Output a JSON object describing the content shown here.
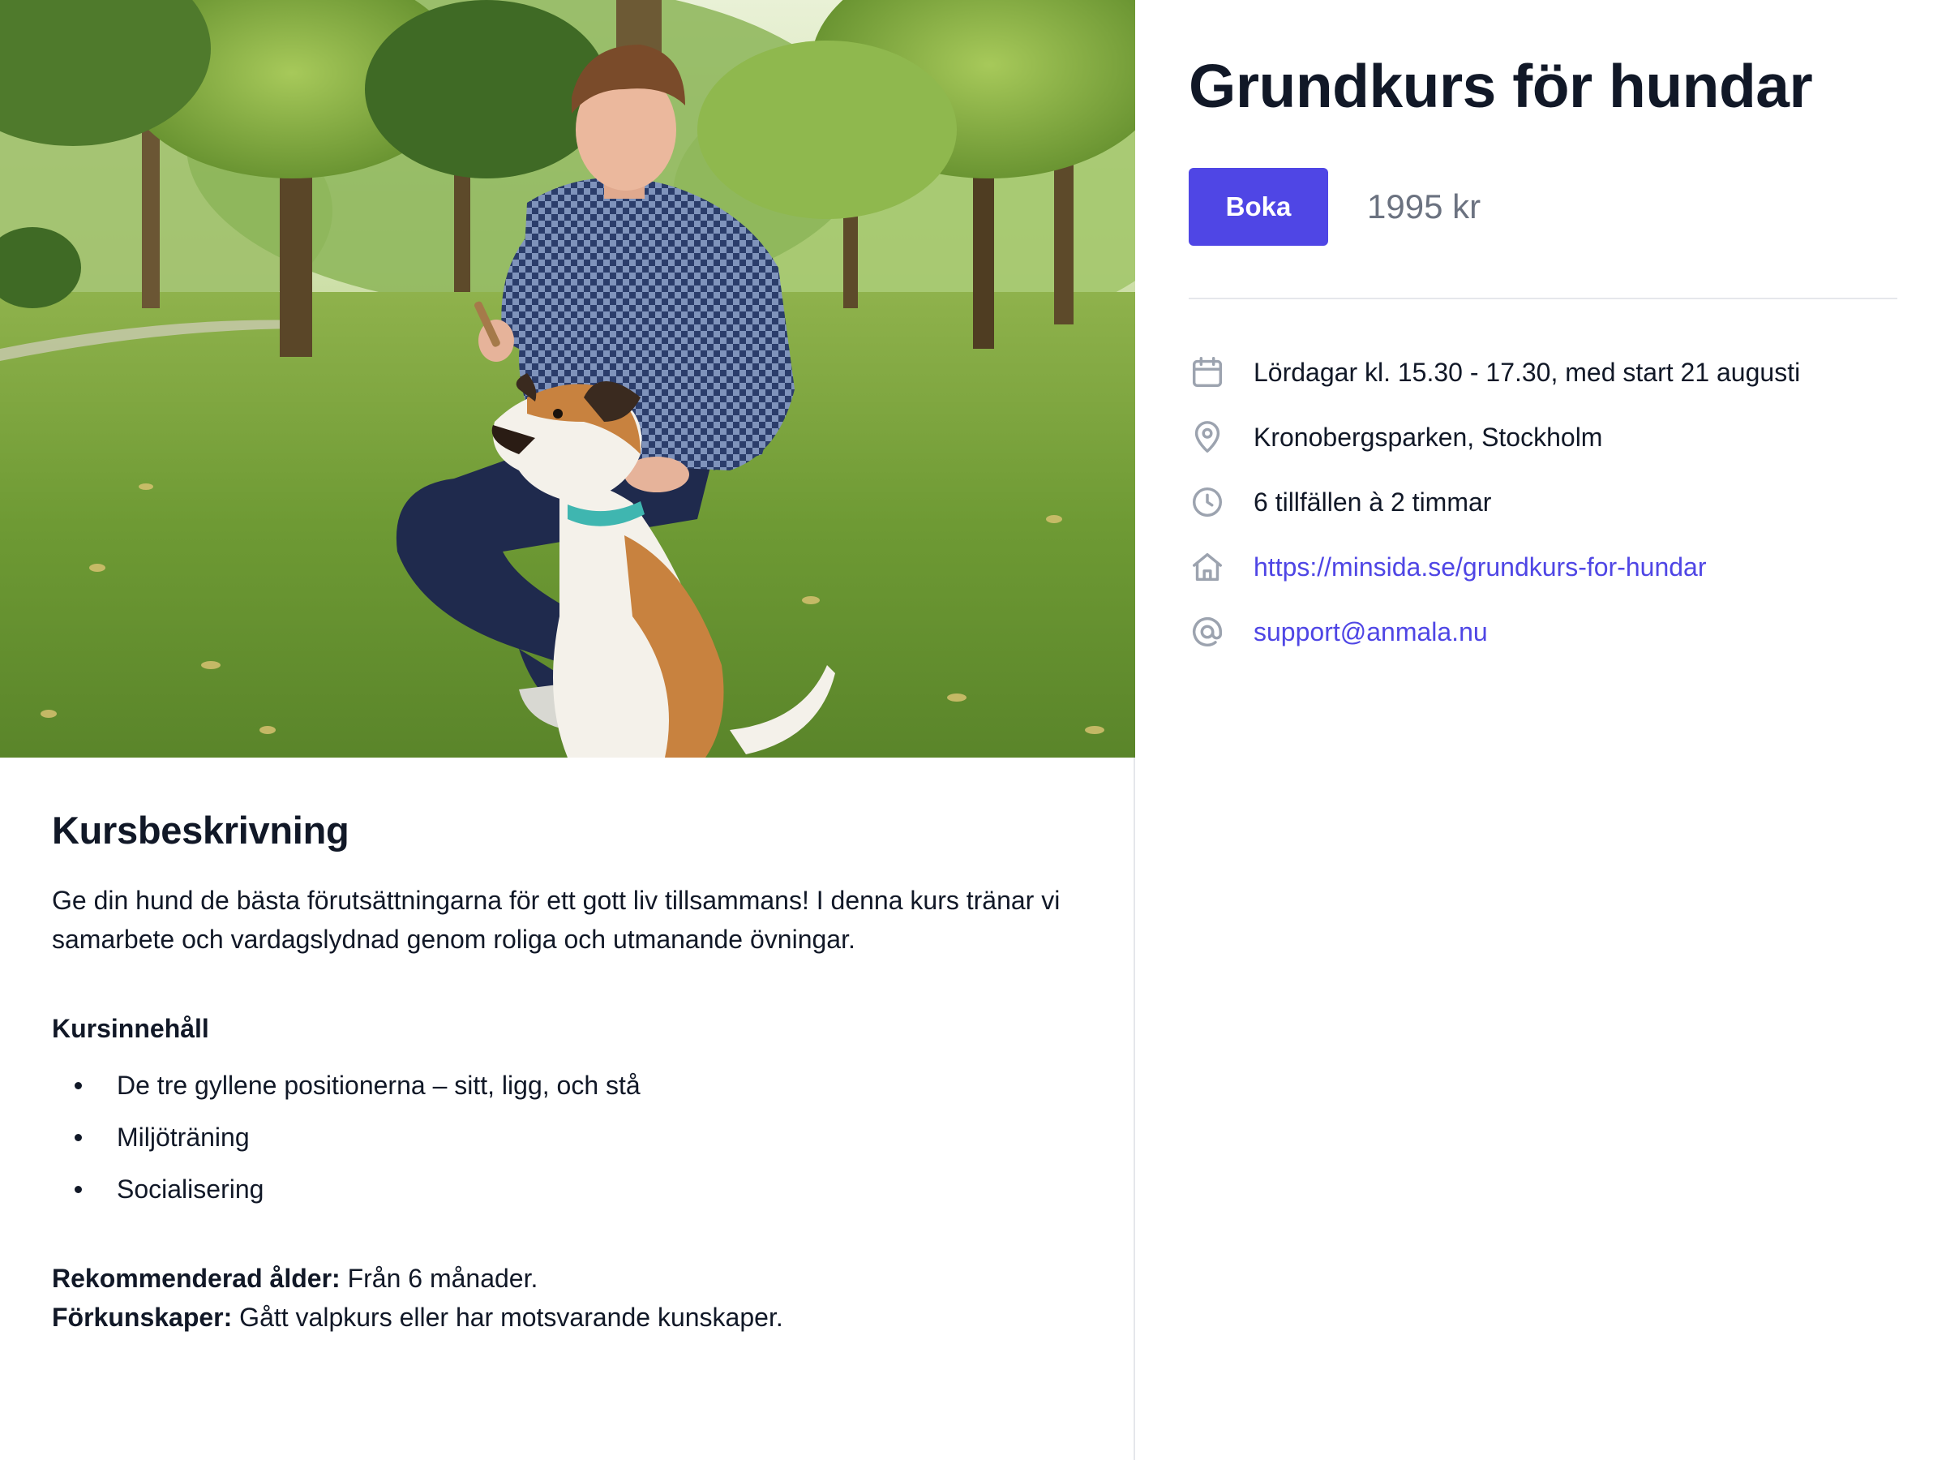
{
  "course": {
    "title": "Grundkurs för hundar",
    "book_label": "Boka",
    "price": "1995 kr"
  },
  "details": [
    {
      "icon": "calendar-icon",
      "text": "Lördagar kl. 15.30 - 17.30, med start 21 augusti"
    },
    {
      "icon": "location-pin-icon",
      "text": "Kronobergsparken, Stockholm"
    },
    {
      "icon": "clock-icon",
      "text": "6 tillfällen à 2 timmar"
    },
    {
      "icon": "home-icon",
      "text": "https://minsida.se/grundkurs-for-hundar"
    },
    {
      "icon": "at-sign-icon",
      "text": "support@anmala.nu"
    }
  ],
  "description": {
    "heading": "Kursbeskrivning",
    "body": "Ge din hund de bästa förutsättningarna för ett gott liv tillsammans! I denna kurs tränar vi samarbete och vardagslydnad genom roliga och utmanande övningar.",
    "content_heading": "Kursinnehåll",
    "content_items": [
      "De tre gyllene positionerna – sitt, ligg, och stå",
      "Miljöträning",
      "Socialisering"
    ],
    "age_label": "Rekommenderad ålder:",
    "age_value": " Från 6 månader.",
    "prereq_label": "Förkunskaper:",
    "prereq_value": " Gått valpkurs eller har motsvarande kunskaper."
  },
  "colors": {
    "accent": "#4f46e5",
    "text": "#111827",
    "muted": "#6b7280",
    "border": "#e5e7eb"
  }
}
